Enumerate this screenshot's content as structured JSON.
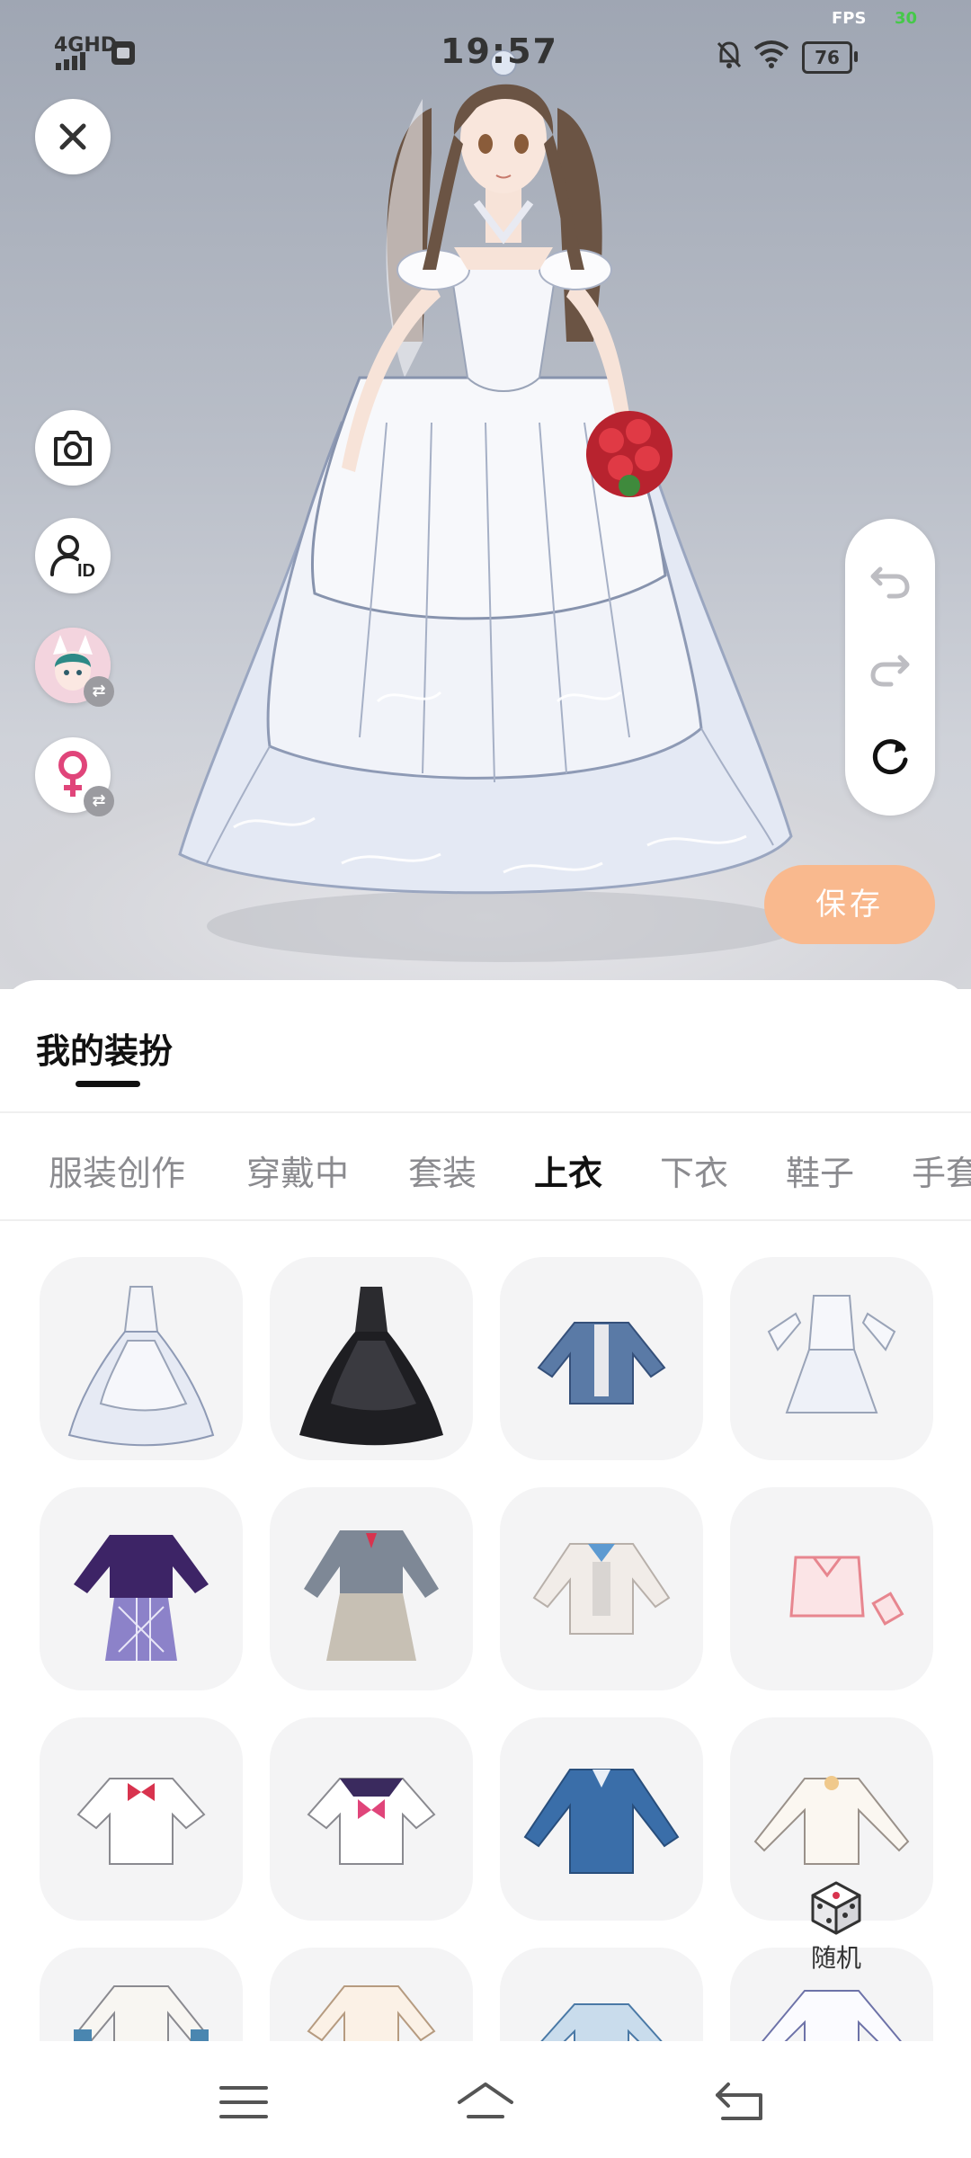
{
  "status_bar": {
    "network": "4GHD",
    "time": "19:57",
    "fps_label": "FPS",
    "fps_value": "30",
    "battery": "76"
  },
  "side_controls": {
    "close": "close-icon",
    "camera": "camera-icon",
    "id": "profile-id-icon",
    "avatar": "character-avatar",
    "gender": "female-icon"
  },
  "history": {
    "undo": "undo-icon",
    "redo": "redo-icon",
    "reset": "reset-icon"
  },
  "save_label": "保存",
  "sheet": {
    "title": "我的装扮",
    "tabs": [
      {
        "label": "服装创作",
        "active": false
      },
      {
        "label": "穿戴中",
        "active": false
      },
      {
        "label": "套装",
        "active": false
      },
      {
        "label": "上衣",
        "active": true
      },
      {
        "label": "下衣",
        "active": false
      },
      {
        "label": "鞋子",
        "active": false
      },
      {
        "label": "手套",
        "active": false
      }
    ],
    "items": [
      "white-ball-gown",
      "black-ball-gown",
      "denim-jacket",
      "white-lolita-dress",
      "purple-sweater-plaid-skirt",
      "grey-uniform-dress",
      "white-cardigan",
      "pink-crop-top",
      "white-shirt-bow",
      "sailor-shirt",
      "blue-blazer",
      "cream-long-sleeve-blouse",
      "fur-cuff-top",
      "beige-blouse",
      "blue-uniform-jacket",
      "lace-blouse"
    ]
  },
  "random_label": "随机",
  "navbar": {
    "menu": "menu-icon",
    "home": "home-icon",
    "back": "back-icon"
  },
  "colors": {
    "accent": "#f9b98e",
    "text": "#111111",
    "muted": "#8b8b8f"
  }
}
